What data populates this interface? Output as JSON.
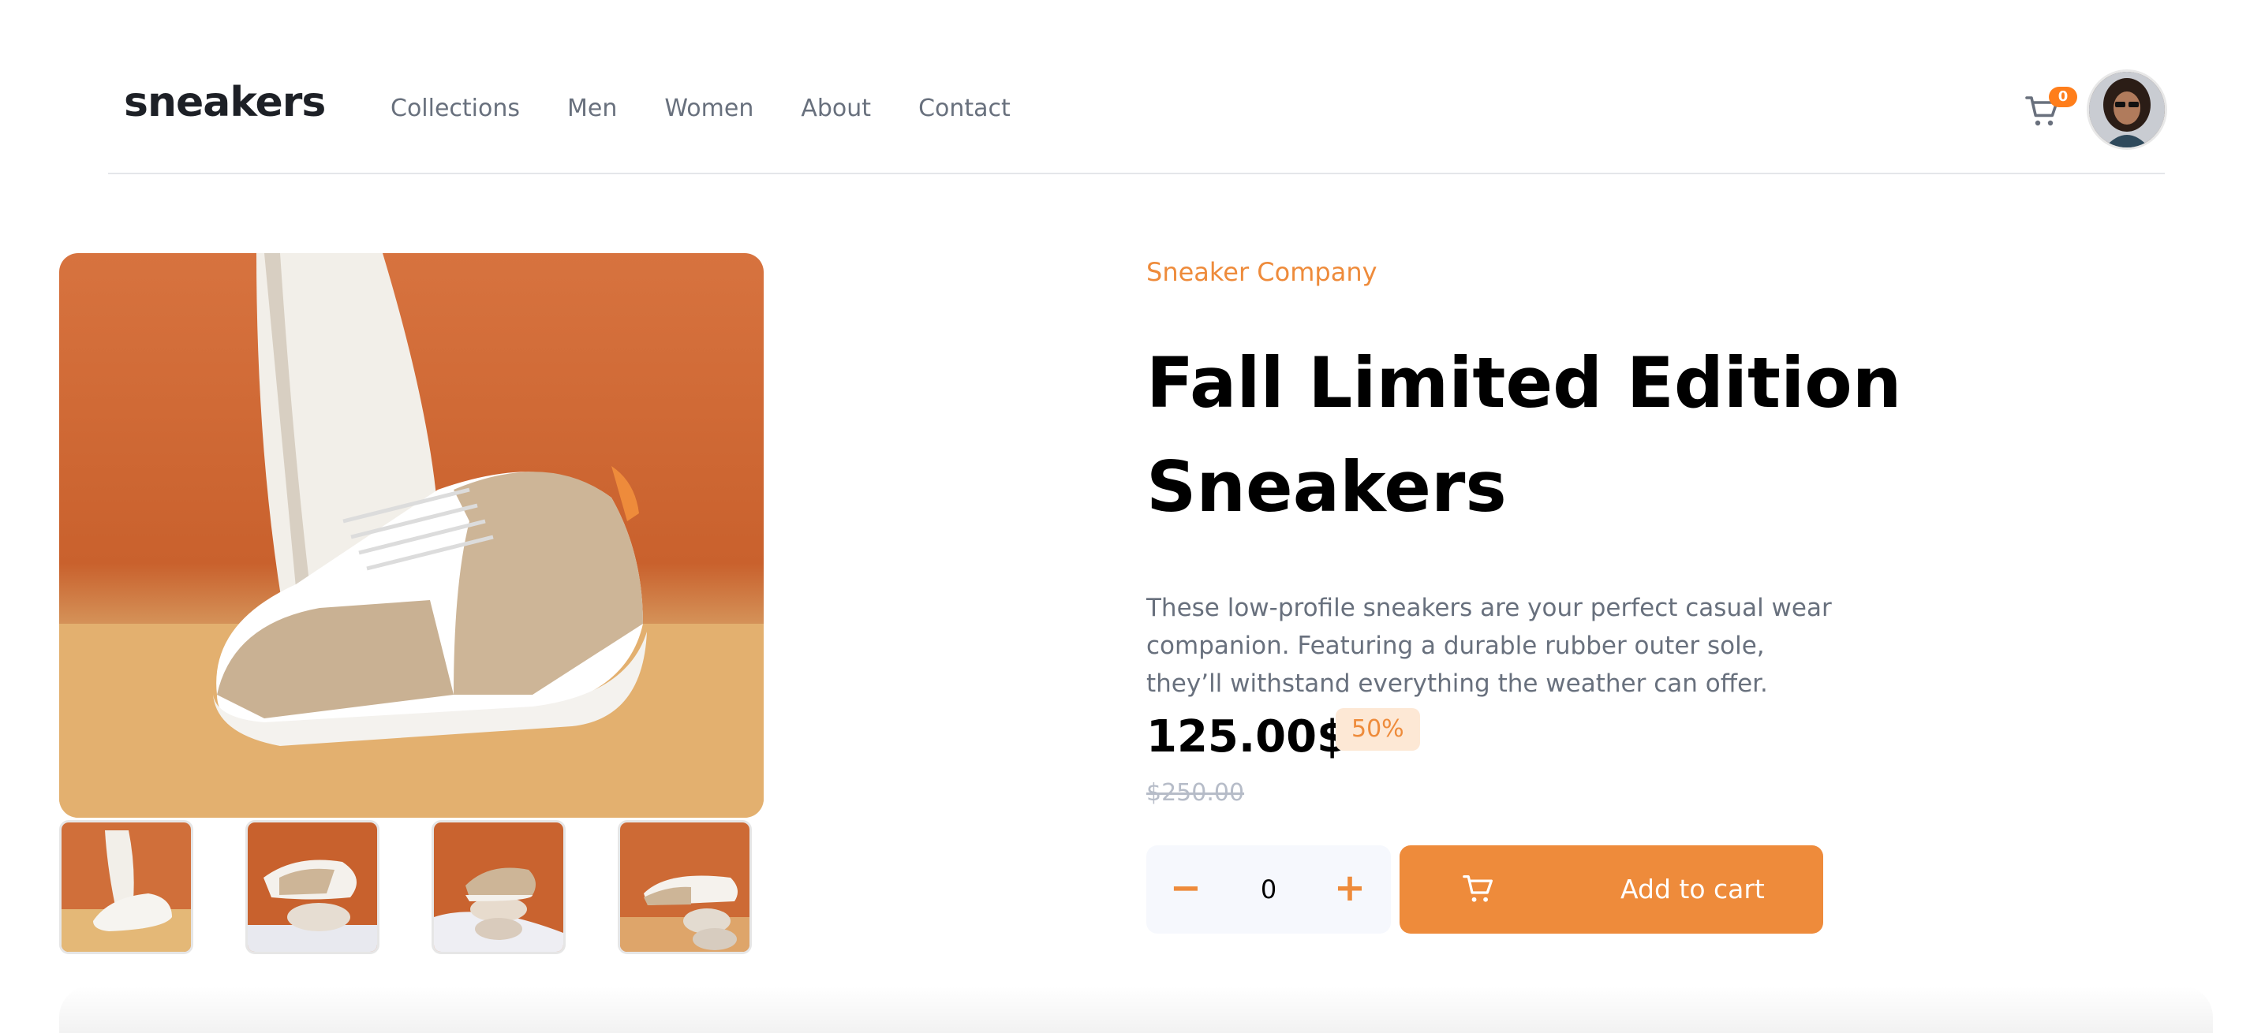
{
  "header": {
    "logo": "sneakers",
    "nav": [
      "Collections",
      "Men",
      "Women",
      "About",
      "Contact"
    ],
    "cart_count": "0",
    "cart_icon": "cart-icon",
    "avatar": "user-avatar"
  },
  "product": {
    "company": "Sneaker Company",
    "title_line1": "Fall Limited Edition",
    "title_line2": "Sneakers",
    "description": "These low-profile sneakers are your perfect casual wear companion. Featuring a durable rubber outer sole, they’ll withstand everything the weather can offer.",
    "price": "125.00$",
    "discount": "50%",
    "old_price": "$250.00",
    "quantity": "0",
    "minus": "−",
    "plus": "+",
    "add_to_cart": "Add to cart"
  },
  "colors": {
    "accent": "#ee8b3b",
    "accent_pale": "#fde8d5",
    "text_dark": "#1d2026",
    "text_grey": "#68707d"
  }
}
